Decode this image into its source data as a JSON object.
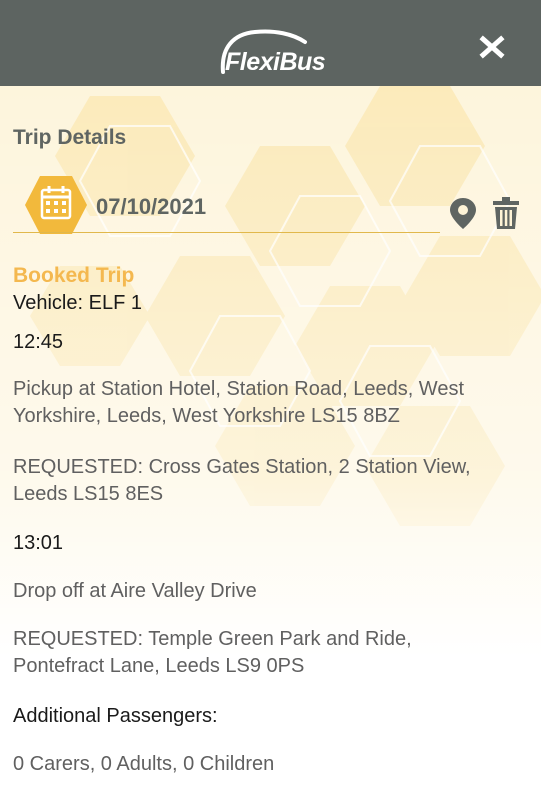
{
  "header": {
    "logo_text": "FlexiBus",
    "close_label": "×",
    "background_color": "#5d6461"
  },
  "trip": {
    "title": "Trip Details",
    "date": "07/10/2021",
    "status": "Booked Trip",
    "vehicle": "Vehicle: ELF 1",
    "pickup_time": "12:45",
    "pickup_line1": "Pickup at Station Hotel, Station Road, Leeds, West",
    "pickup_line2": "Yorkshire, Leeds, West Yorkshire LS15 8BZ",
    "pickup_requested_line1": "REQUESTED: Cross Gates Station, 2 Station View,",
    "pickup_requested_line2": "Leeds LS15 8ES",
    "dropoff_time": "13:01",
    "dropoff": "Drop off at Aire Valley Drive",
    "dropoff_requested_line1": "REQUESTED: Temple Green Park and Ride,",
    "dropoff_requested_line2": "Pontefract Lane, Leeds LS9 0PS",
    "passengers_label": "Additional Passengers:",
    "passengers_value": "0 Carers, 0 Adults, 0 Children"
  },
  "icons": {
    "calendar": "calendar-icon",
    "location": "map-pin-icon",
    "delete": "trash-icon",
    "close": "close-icon"
  },
  "colors": {
    "accent": "#f4b84f",
    "hex_gold": "#f2b93c",
    "text_grey": "#5f6562"
  }
}
